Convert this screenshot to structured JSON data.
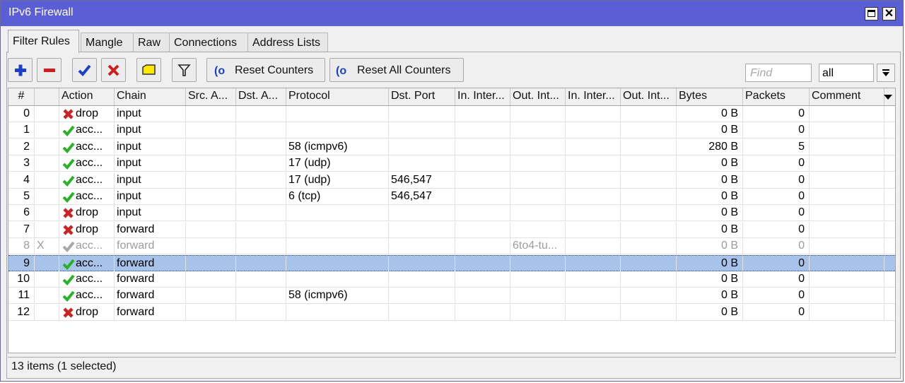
{
  "window": {
    "title": "IPv6 Firewall"
  },
  "tabs": [
    {
      "label": "Filter Rules",
      "active": true
    },
    {
      "label": "Mangle",
      "active": false
    },
    {
      "label": "Raw",
      "active": false
    },
    {
      "label": "Connections",
      "active": false
    },
    {
      "label": "Address Lists",
      "active": false
    }
  ],
  "toolbar": {
    "icons": [
      "add-icon",
      "remove-icon",
      "enable-check-icon",
      "disable-x-icon",
      "comment-icon",
      "filter-icon"
    ],
    "reset_counters_label": "Reset Counters",
    "reset_all_counters_label": "Reset All Counters",
    "find_placeholder": "Find",
    "filter_select_value": "all"
  },
  "table": {
    "columns": [
      "#",
      "",
      "Action",
      "Chain",
      "Src. A...",
      "Dst. A...",
      "Protocol",
      "Dst. Port",
      "In. Inter...",
      "Out. Int...",
      "In. Inter...",
      "Out. Int...",
      "Bytes",
      "Packets",
      "Comment"
    ],
    "rows": [
      {
        "num": "0",
        "flag": "",
        "action": "drop",
        "action_type": "drop",
        "chain": "input",
        "protocol": "",
        "dst_port": "",
        "out_int": "",
        "bytes": "0 B",
        "packets": "0",
        "selected": false,
        "disabled": false
      },
      {
        "num": "1",
        "flag": "",
        "action": "acc...",
        "action_type": "accept",
        "chain": "input",
        "protocol": "",
        "dst_port": "",
        "out_int": "",
        "bytes": "0 B",
        "packets": "0",
        "selected": false,
        "disabled": false
      },
      {
        "num": "2",
        "flag": "",
        "action": "acc...",
        "action_type": "accept",
        "chain": "input",
        "protocol": "58 (icmpv6)",
        "dst_port": "",
        "out_int": "",
        "bytes": "280 B",
        "packets": "5",
        "selected": false,
        "disabled": false
      },
      {
        "num": "3",
        "flag": "",
        "action": "acc...",
        "action_type": "accept",
        "chain": "input",
        "protocol": "17 (udp)",
        "dst_port": "",
        "out_int": "",
        "bytes": "0 B",
        "packets": "0",
        "selected": false,
        "disabled": false
      },
      {
        "num": "4",
        "flag": "",
        "action": "acc...",
        "action_type": "accept",
        "chain": "input",
        "protocol": "17 (udp)",
        "dst_port": "546,547",
        "out_int": "",
        "bytes": "0 B",
        "packets": "0",
        "selected": false,
        "disabled": false
      },
      {
        "num": "5",
        "flag": "",
        "action": "acc...",
        "action_type": "accept",
        "chain": "input",
        "protocol": "6 (tcp)",
        "dst_port": "546,547",
        "out_int": "",
        "bytes": "0 B",
        "packets": "0",
        "selected": false,
        "disabled": false
      },
      {
        "num": "6",
        "flag": "",
        "action": "drop",
        "action_type": "drop",
        "chain": "input",
        "protocol": "",
        "dst_port": "",
        "out_int": "",
        "bytes": "0 B",
        "packets": "0",
        "selected": false,
        "disabled": false
      },
      {
        "num": "7",
        "flag": "",
        "action": "drop",
        "action_type": "drop",
        "chain": "forward",
        "protocol": "",
        "dst_port": "",
        "out_int": "",
        "bytes": "0 B",
        "packets": "0",
        "selected": false,
        "disabled": false
      },
      {
        "num": "8",
        "flag": "X",
        "action": "acc...",
        "action_type": "accept",
        "chain": "forward",
        "protocol": "",
        "dst_port": "",
        "out_int": "6to4-tu...",
        "bytes": "0 B",
        "packets": "0",
        "selected": false,
        "disabled": true
      },
      {
        "num": "9",
        "flag": "",
        "action": "acc...",
        "action_type": "accept",
        "chain": "forward",
        "protocol": "",
        "dst_port": "",
        "out_int": "",
        "bytes": "0 B",
        "packets": "0",
        "selected": true,
        "disabled": false
      },
      {
        "num": "10",
        "flag": "",
        "action": "acc...",
        "action_type": "accept",
        "chain": "forward",
        "protocol": "",
        "dst_port": "",
        "out_int": "",
        "bytes": "0 B",
        "packets": "0",
        "selected": false,
        "disabled": false
      },
      {
        "num": "11",
        "flag": "",
        "action": "acc...",
        "action_type": "accept",
        "chain": "forward",
        "protocol": "58 (icmpv6)",
        "dst_port": "",
        "out_int": "",
        "bytes": "0 B",
        "packets": "0",
        "selected": false,
        "disabled": false
      },
      {
        "num": "12",
        "flag": "",
        "action": "drop",
        "action_type": "drop",
        "chain": "forward",
        "protocol": "",
        "dst_port": "",
        "out_int": "",
        "bytes": "0 B",
        "packets": "0",
        "selected": false,
        "disabled": false
      }
    ]
  },
  "status": {
    "text": "13 items (1 selected)"
  },
  "colors": {
    "titlebar": "#5b5fd6",
    "selected_row": "#a7c3ea",
    "accept": "#27b327",
    "drop": "#cc2222",
    "disabled_text": "#9c9c9c"
  }
}
